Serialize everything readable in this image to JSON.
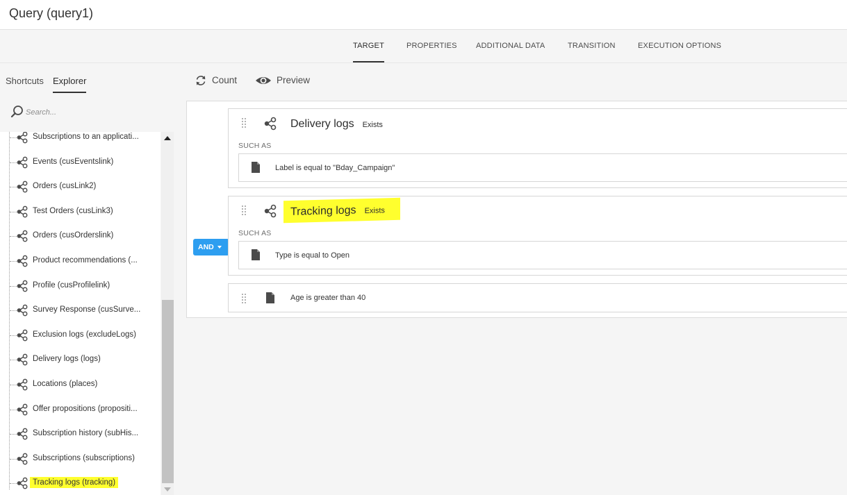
{
  "window": {
    "title": "Query (query1)"
  },
  "tabs": [
    {
      "label": "TARGET",
      "active": true
    },
    {
      "label": "PROPERTIES",
      "active": false
    },
    {
      "label": "ADDITIONAL DATA",
      "active": false
    },
    {
      "label": "TRANSITION",
      "active": false
    },
    {
      "label": "EXECUTION OPTIONS",
      "active": false
    }
  ],
  "sidebar": {
    "tabs": [
      {
        "label": "Shortcuts",
        "active": false
      },
      {
        "label": "Explorer",
        "active": true
      }
    ],
    "search_placeholder": "Search...",
    "items": [
      {
        "label": "Subscriptions to an applicati...",
        "icon": "link-icon"
      },
      {
        "label": "Events (cusEventslink)",
        "icon": "link-icon"
      },
      {
        "label": "Orders (cusLink2)",
        "icon": "link-icon"
      },
      {
        "label": "Test Orders (cusLink3)",
        "icon": "link-icon"
      },
      {
        "label": "Orders (cusOrderslink)",
        "icon": "link-icon"
      },
      {
        "label": "Product recommendations (...",
        "icon": "link-icon"
      },
      {
        "label": "Profile (cusProfilelink)",
        "icon": "link-icon"
      },
      {
        "label": "Survey Response (cusSurve...",
        "icon": "link-icon"
      },
      {
        "label": "Exclusion logs (excludeLogs)",
        "icon": "link-icon"
      },
      {
        "label": "Delivery logs (logs)",
        "icon": "link-icon"
      },
      {
        "label": "Locations (places)",
        "icon": "link-icon"
      },
      {
        "label": "Offer propositions (propositi...",
        "icon": "link-icon"
      },
      {
        "label": "Subscription history (subHis...",
        "icon": "link-icon"
      },
      {
        "label": "Subscriptions (subscriptions)",
        "icon": "link-icon"
      },
      {
        "label": "Tracking logs (tracking)",
        "icon": "link-icon",
        "highlighted": true
      }
    ]
  },
  "toolbar": {
    "count_label": "Count",
    "preview_label": "Preview"
  },
  "query": {
    "operator": "AND",
    "conditions": [
      {
        "title": "Delivery logs",
        "qualifier": "Exists",
        "such_as_label": "SUCH AS",
        "rule": "Label is equal to \"Bday_Campaign\""
      },
      {
        "title": "Tracking logs",
        "qualifier": "Exists",
        "such_as_label": "SUCH AS",
        "rule": "Type is equal to Open",
        "highlighted": true
      },
      {
        "rule": "Age is greater than 40"
      }
    ]
  },
  "colors": {
    "highlight": "#ffff2e",
    "and_button": "#2d9ef0"
  }
}
